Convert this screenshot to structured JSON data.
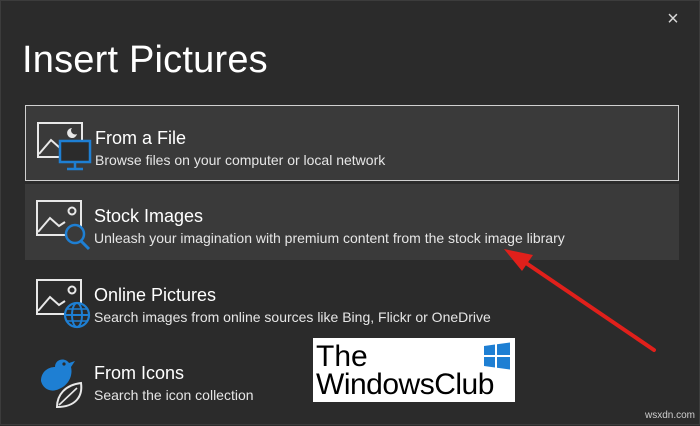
{
  "dialog": {
    "title": "Insert Pictures",
    "close_glyph": "×",
    "accent": "#1e7fd3"
  },
  "options": [
    {
      "title": "From a File",
      "description": "Browse files on your computer or local network",
      "icon": "picture-monitor-icon"
    },
    {
      "title": "Stock Images",
      "description": "Unleash your imagination with premium content from the stock image library",
      "icon": "picture-search-icon"
    },
    {
      "title": "Online Pictures",
      "description": "Search images from online sources like Bing, Flickr or OneDrive",
      "icon": "picture-globe-icon"
    },
    {
      "title": "From Icons",
      "description": "Search the icon collection",
      "icon": "bird-leaf-icon"
    }
  ],
  "watermark": {
    "line1": "The",
    "line2": "WindowsClub",
    "site": "wsxdn.com"
  },
  "annotation": {
    "arrow_color": "#e0201b"
  }
}
